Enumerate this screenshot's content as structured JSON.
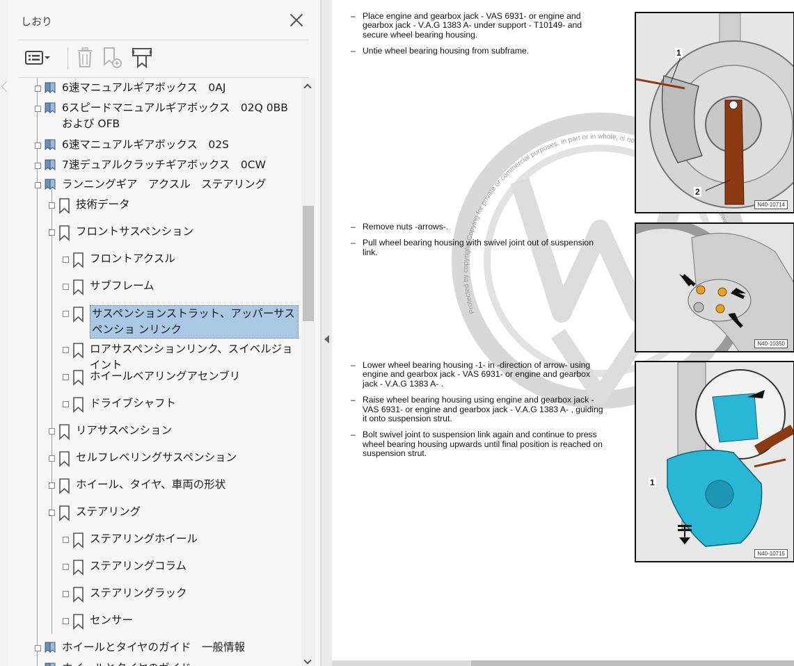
{
  "panel": {
    "title": "しおり",
    "close_icon": "close-icon",
    "toolbar": {
      "options_icon": "list-options-icon",
      "delete_icon": "trash-icon",
      "new_bookmark_icon": "new-bookmark-icon",
      "expand_icon": "expand-bookmark-icon"
    }
  },
  "bookmarks": [
    {
      "label": "6速マニュアルギアボックス　0AJ",
      "level": 0
    },
    {
      "label": "6スピードマニュアルギアボックス　02Q 0BB および OFB",
      "level": 0
    },
    {
      "label": "6速マニュアルギアボックス　02S",
      "level": 0
    },
    {
      "label": "7速デュアルクラッチギアボックス　0CW",
      "level": 0
    },
    {
      "label": "ランニングギア　アクスル　ステアリング",
      "level": 0
    },
    {
      "label": "技術データ",
      "level": 1
    },
    {
      "label": "フロントサスペンション",
      "level": 1
    },
    {
      "label": "フロントアクスル",
      "level": 2
    },
    {
      "label": "サブフレーム",
      "level": 2
    },
    {
      "label": "サスペンションストラット、アッパーサスペンショ ンリンク",
      "level": 2,
      "selected": true
    },
    {
      "label": "ロアサスペンションリンク、スイベルジョイント",
      "level": 2
    },
    {
      "label": "ホイールベアリングアセンブリ",
      "level": 2
    },
    {
      "label": "ドライブシャフト",
      "level": 2
    },
    {
      "label": "リアサスペンション",
      "level": 1
    },
    {
      "label": "セルフレベリングサスペンション",
      "level": 1
    },
    {
      "label": "ホイール、タイヤ、車両の形状",
      "level": 1
    },
    {
      "label": "ステアリング",
      "level": 1
    },
    {
      "label": "ステアリングホイール",
      "level": 2
    },
    {
      "label": "ステアリングコラム",
      "level": 2
    },
    {
      "label": "ステアリングラック",
      "level": 2
    },
    {
      "label": "センサー",
      "level": 2
    },
    {
      "label": "ホイールとタイヤのガイド　一般情報",
      "level": 0
    },
    {
      "label": "ホイールとタイヤのガイド",
      "level": 0
    }
  ],
  "document": {
    "block1": [
      "Place engine and gearbox jack - VAS 6931- or engine and gearbox jack - V.A.G 1383 A- under support - T10149- and secure wheel bearing housing.",
      "Untie wheel bearing housing from subframe."
    ],
    "block2": [
      "Remove nuts -arrows-.",
      "Pull wheel bearing housing with swivel joint out of suspension link."
    ],
    "block3": [
      "Lower wheel bearing housing -1- in -direction of arrow- using engine and gearbox jack - VAS 6931- or engine and gearbox jack - V.A.G 1383 A- .",
      "Raise wheel bearing housing using engine and gearbox jack - VAS 6931- or engine and gearbox jack - V.A.G 1383 A- , guiding it onto suspension strut.",
      "Bolt swivel joint to suspension link again and continue to press wheel bearing housing upwards until final position is reached on suspension strut."
    ],
    "figures": [
      {
        "code": "N40-10714",
        "callouts": [
          "1",
          "2"
        ]
      },
      {
        "code": "N40-10350",
        "callouts": []
      },
      {
        "code": "N40-10715",
        "callouts": [
          "1"
        ]
      }
    ],
    "watermark_text": "Protected by copyright. Copying for private or commercial purposes, in part or in whole, is not permitted unless authorised by Volkswagen AG. Volkswagen AG"
  },
  "colors": {
    "selection": "#aac8e4",
    "rust_tool": "#8b3a12",
    "cyan_part": "#2ab7d6"
  }
}
